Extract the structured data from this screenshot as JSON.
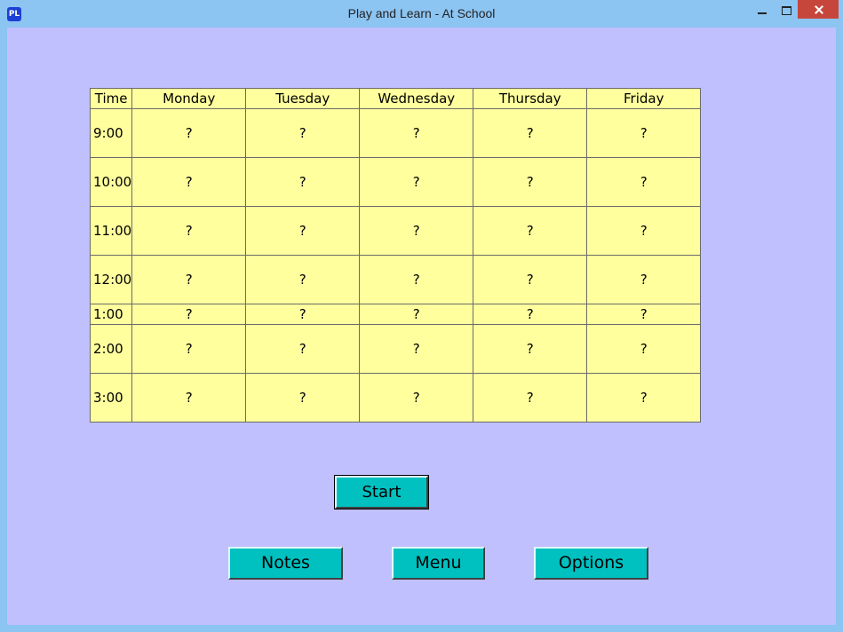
{
  "window": {
    "title": "Play and Learn - At School",
    "app_icon_text": "PL"
  },
  "schedule": {
    "header": [
      "Time",
      "Monday",
      "Tuesday",
      "Wednesday",
      "Thursday",
      "Friday"
    ],
    "rows": [
      {
        "time": "9:00",
        "cells": [
          "?",
          "?",
          "?",
          "?",
          "?"
        ]
      },
      {
        "time": "10:00",
        "cells": [
          "?",
          "?",
          "?",
          "?",
          "?"
        ]
      },
      {
        "time": "11:00",
        "cells": [
          "?",
          "?",
          "?",
          "?",
          "?"
        ]
      },
      {
        "time": "12:00",
        "cells": [
          "?",
          "?",
          "?",
          "?",
          "?"
        ]
      },
      {
        "time": "1:00",
        "cells": [
          "?",
          "?",
          "?",
          "?",
          "?"
        ]
      },
      {
        "time": "2:00",
        "cells": [
          "?",
          "?",
          "?",
          "?",
          "?"
        ]
      },
      {
        "time": "3:00",
        "cells": [
          "?",
          "?",
          "?",
          "?",
          "?"
        ]
      }
    ]
  },
  "buttons": {
    "start": "Start",
    "notes": "Notes",
    "menu": "Menu",
    "options": "Options"
  },
  "colors": {
    "background": "#c0c0ff",
    "table_fill": "#ffff9e",
    "button_fill": "#00c0c0",
    "titlebar": "#8cc4f2",
    "close_button": "#c7463c"
  }
}
